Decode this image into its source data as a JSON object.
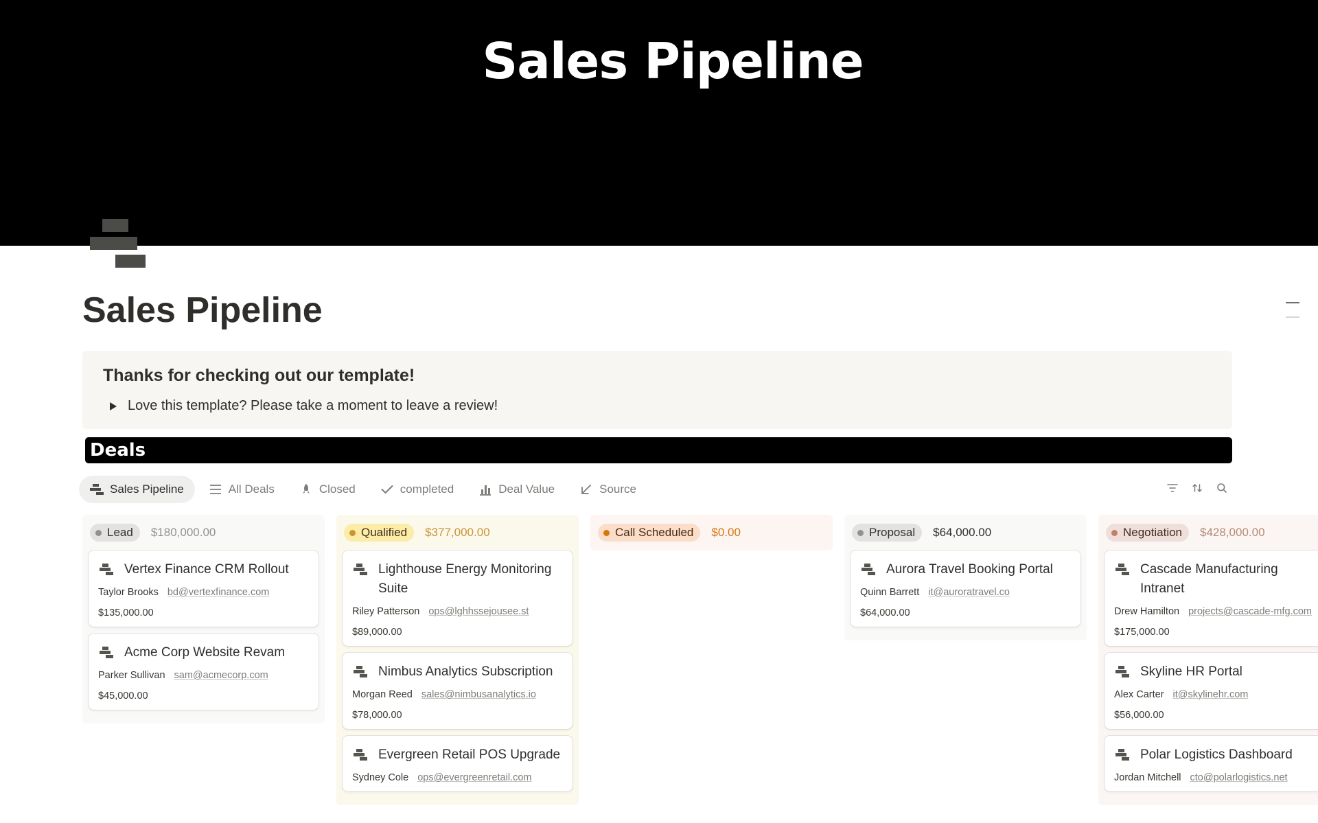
{
  "cover": {
    "title": "Sales Pipeline"
  },
  "page": {
    "title": "Sales Pipeline",
    "icon": "pipeline-icon"
  },
  "callout": {
    "heading": "Thanks for checking out our template!",
    "toggle_text": "Love this template? Please take a moment to leave a review!"
  },
  "section": {
    "title": "Deals"
  },
  "views": [
    {
      "label": "Sales Pipeline",
      "icon": "pipeline-icon",
      "active": true
    },
    {
      "label": "All Deals",
      "icon": "list-icon",
      "active": false
    },
    {
      "label": "Closed",
      "icon": "rocket-icon",
      "active": false
    },
    {
      "label": "completed",
      "icon": "check-icon",
      "active": false
    },
    {
      "label": "Deal Value",
      "icon": "bar-chart-icon",
      "active": false
    },
    {
      "label": "Source",
      "icon": "arrow-down-left-icon",
      "active": false
    }
  ],
  "tools": [
    "filter-icon",
    "sort-icon",
    "search-icon"
  ],
  "columns": [
    {
      "status": "Lead",
      "total": "$180,000.00",
      "colors": {
        "bg": "#f9f9f8",
        "pill": "#e3e2e0",
        "dot": "#91918e",
        "text": "#32302c",
        "sum": "#91918e"
      },
      "cards": [
        {
          "title": "Vertex Finance CRM Rollout",
          "contact": "Taylor Brooks",
          "email": "bd@vertexfinance.com",
          "value": "$135,000.00"
        },
        {
          "title": "Acme Corp Website Revam",
          "contact": "Parker Sullivan",
          "email": "sam@acmecorp.com",
          "value": "$45,000.00"
        }
      ]
    },
    {
      "status": "Qualified",
      "total": "$377,000.00",
      "colors": {
        "bg": "#fbf8ec",
        "pill": "#fbeca7",
        "dot": "#cb9433",
        "text": "#402c1b",
        "sum": "#cb9433"
      },
      "cards": [
        {
          "title": "Lighthouse Energy Monitoring Suite",
          "contact": "Riley Patterson",
          "email": "ops@lghhssejousee.st",
          "value": "$89,000.00"
        },
        {
          "title": "Nimbus Analytics Subscription",
          "contact": "Morgan Reed",
          "email": "sales@nimbusanalytics.io",
          "value": "$78,000.00"
        },
        {
          "title": "Evergreen Retail POS Upgrade",
          "contact": "Sydney Cole",
          "email": "ops@evergreenretail.com",
          "value": ""
        }
      ]
    },
    {
      "status": "Call Scheduled",
      "total": "$0.00",
      "colors": {
        "bg": "#fcf5f2",
        "pill": "#fadec9",
        "dot": "#d9730d",
        "text": "#49290e",
        "sum": "#d9730d"
      },
      "cards": []
    },
    {
      "status": "Proposal",
      "total": "$64,000.00",
      "colors": {
        "bg": "#f9f9f8",
        "pill": "#e3e2e0",
        "dot": "#91918e",
        "text": "#32302c",
        "sum": "#32302c"
      },
      "cards": [
        {
          "title": "Aurora Travel Booking Portal",
          "contact": "Quinn Barrett",
          "email": "it@auroratravel.co",
          "value": "$64,000.00"
        }
      ]
    },
    {
      "status": "Negotiation",
      "total": "$428,000.00",
      "colors": {
        "bg": "#fbf6f3",
        "pill": "#eedfda",
        "dot": "#c47f67",
        "text": "#442a1e",
        "sum": "#b58a76"
      },
      "cards": [
        {
          "title": "Cascade Manufacturing Intranet",
          "contact": "Drew Hamilton",
          "email": "projects@cascade-mfg.com",
          "value": "$175,000.00"
        },
        {
          "title": "Skyline HR Portal",
          "contact": "Alex Carter",
          "email": "it@skylinehr.com",
          "value": "$56,000.00"
        },
        {
          "title": "Polar Logistics Dashboard",
          "contact": "Jordan Mitchell",
          "email": "cto@polarlogistics.net",
          "value": ""
        }
      ]
    }
  ]
}
